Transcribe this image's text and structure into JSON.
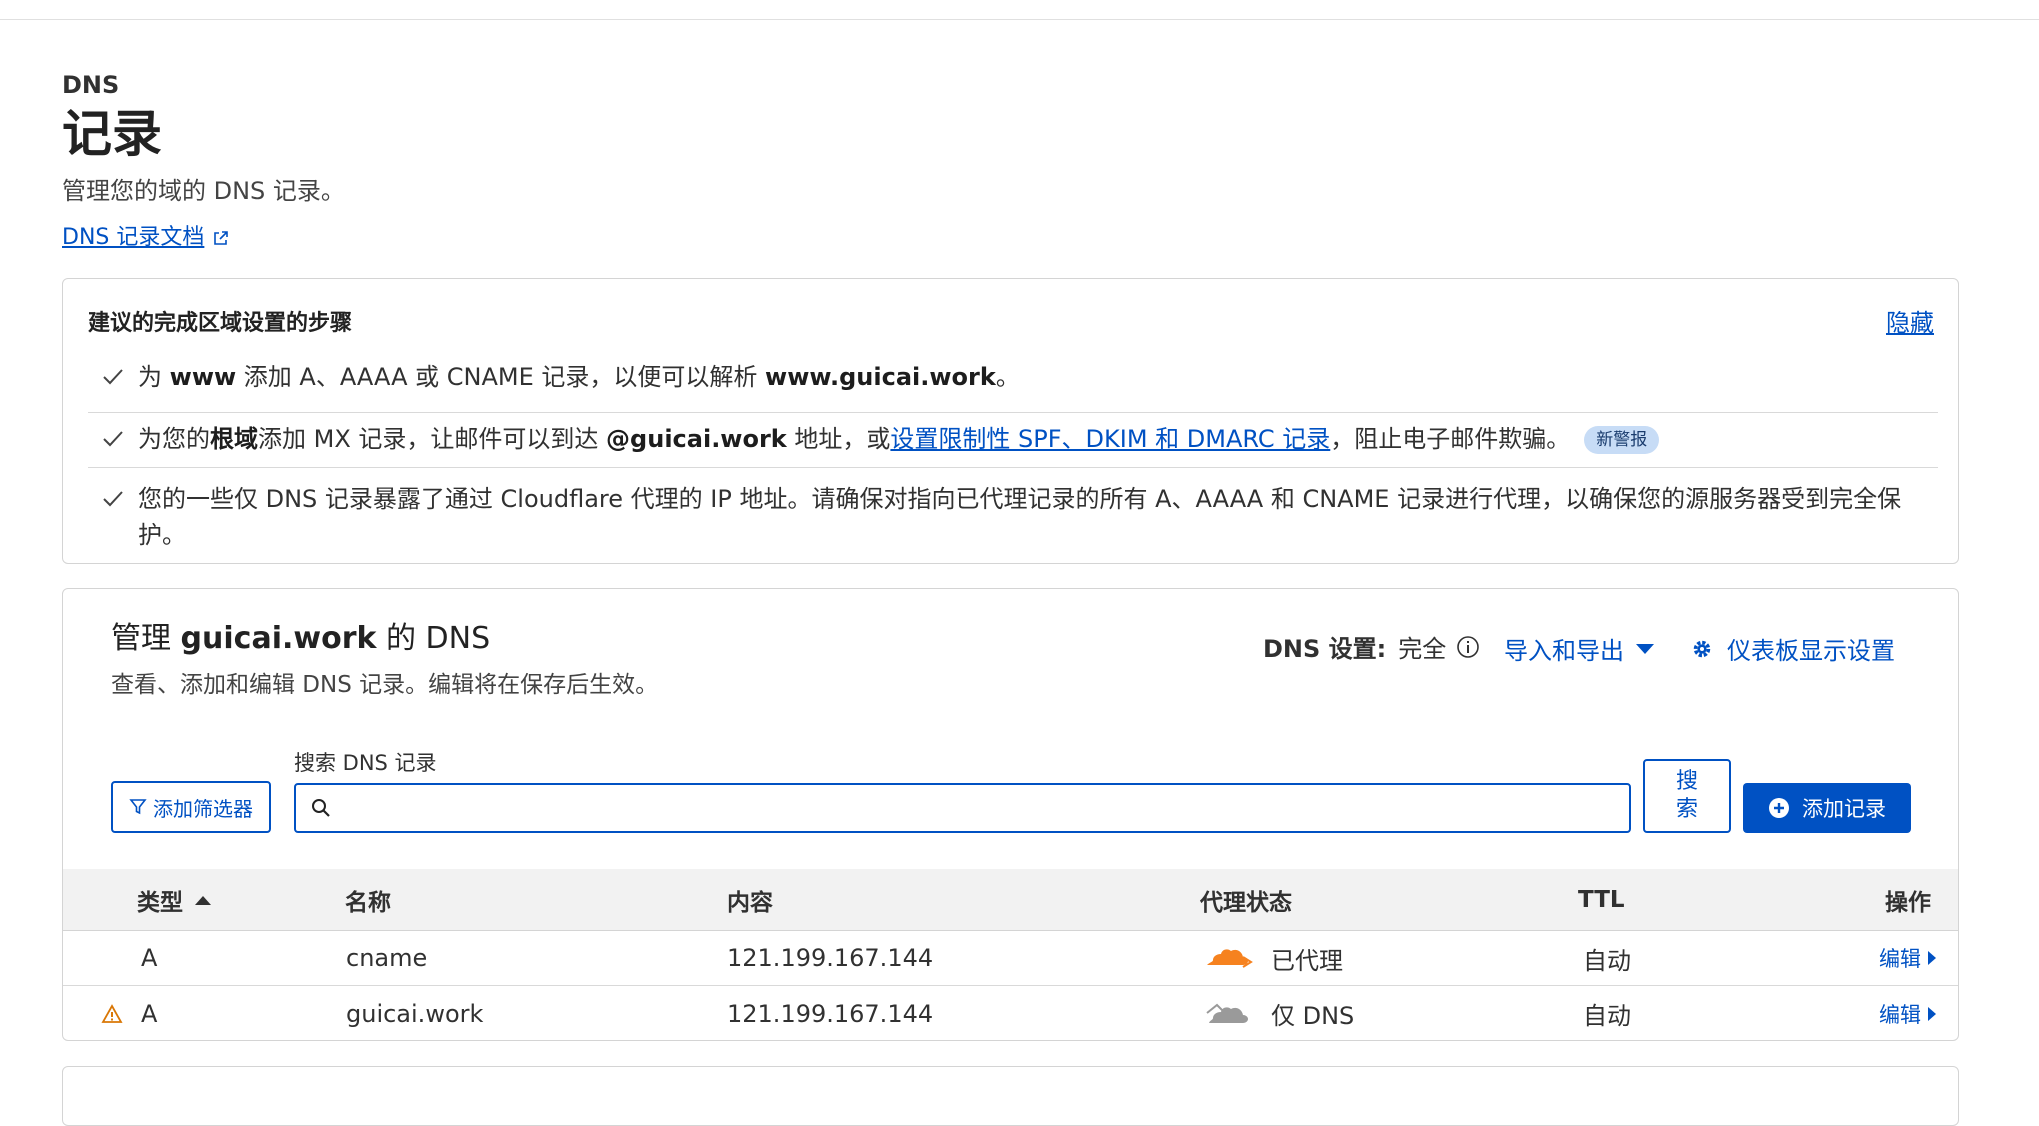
{
  "header": {
    "eyebrow": "DNS",
    "title": "记录",
    "description": "管理您的域的 DNS 记录。",
    "doc_link": "DNS 记录文档"
  },
  "steps": {
    "title": "建议的完成区域设置的步骤",
    "hide_label": "隐藏",
    "items": [
      {
        "p1": "为 ",
        "b1": "www",
        "p2": " 添加 A、AAAA 或 CNAME 记录，以便可以解析 ",
        "b2": "www.guicai.work",
        "p3": "。"
      },
      {
        "p1": "为您的",
        "b1": "根域",
        "p2": "添加 MX 记录，让邮件可以到达 ",
        "b2": "@guicai.work",
        "p3": " 地址，或",
        "link": "设置限制性 SPF、DKIM 和 DMARC 记录",
        "p4": "，阻止电子邮件欺骗。",
        "badge": "新警报"
      },
      {
        "text": "您的一些仅 DNS 记录暴露了通过 Cloudflare 代理的 IP 地址。请确保对指向已代理记录的所有 A、AAAA 和 CNAME 记录进行代理，以确保您的源服务器受到完全保护。"
      }
    ]
  },
  "dns": {
    "title_prefix": "管理 ",
    "title_domain": "guicai.work",
    "title_suffix": " 的 DNS",
    "subtitle": "查看、添加和编辑 DNS 记录。编辑将在保存后生效。",
    "setting_label": "DNS 设置:",
    "setting_value": "完全",
    "import_export": "导入和导出",
    "dashboard_settings": "仪表板显示设置",
    "filter_button": "添加筛选器",
    "search_label": "搜索 DNS 记录",
    "search_placeholder": "",
    "search_button": "搜索",
    "add_record_button": "添加记录",
    "columns": {
      "type": "类型",
      "name": "名称",
      "content": "内容",
      "proxy": "代理状态",
      "ttl": "TTL",
      "actions": "操作"
    },
    "rows": [
      {
        "warning": false,
        "type": "A",
        "name": "cname",
        "content": "121.199.167.144",
        "proxy": "已代理",
        "proxy_color": "#f6821f",
        "ttl": "自动",
        "action": "编辑"
      },
      {
        "warning": true,
        "type": "A",
        "name": "guicai.work",
        "content": "121.199.167.144",
        "proxy": "仅 DNS",
        "proxy_color": "#999999",
        "ttl": "自动",
        "action": "编辑"
      }
    ]
  },
  "colors": {
    "accent": "#0051c3",
    "proxied": "#f6821f",
    "dns_only": "#999999",
    "warning": "#d97706"
  }
}
